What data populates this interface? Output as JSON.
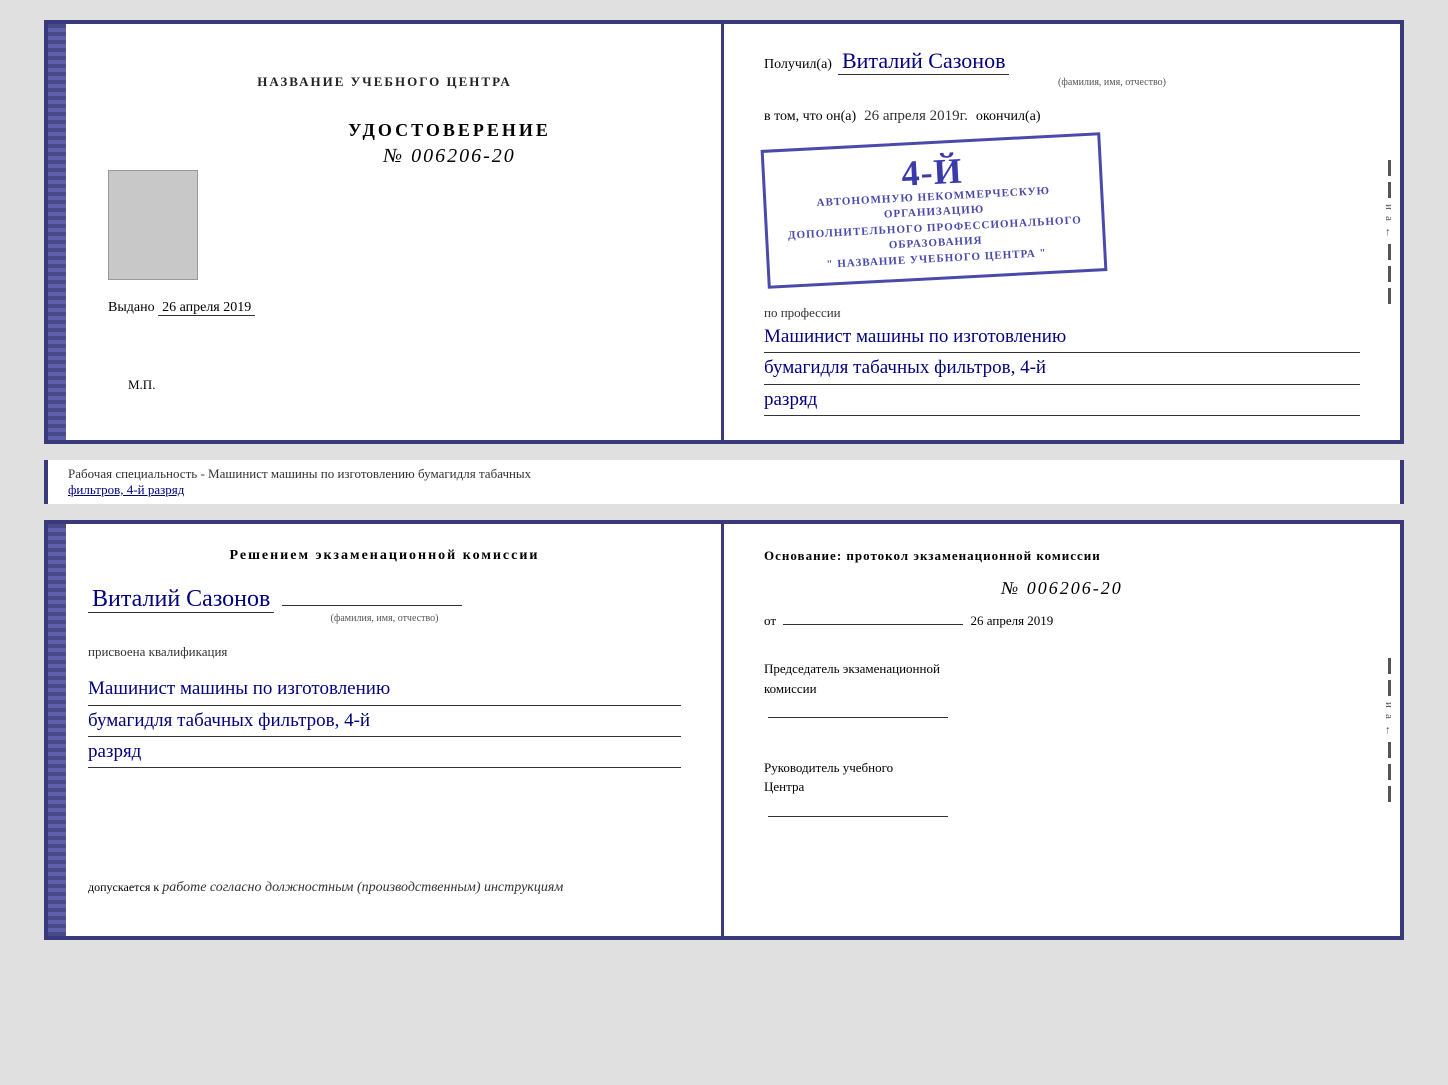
{
  "topCert": {
    "left": {
      "header": "НАЗВАНИЕ УЧЕБНОГО ЦЕНТРА",
      "title": "УДОСТОВЕРЕНИЕ",
      "number": "№ 006206-20",
      "issuedLabel": "Выдано",
      "issuedDate": "26 апреля 2019",
      "mp": "М.П."
    },
    "right": {
      "receivedLabel": "Получил(а)",
      "recipientName": "Виталий Сазонов",
      "recipientSubLabel": "(фамилия, имя, отчество)",
      "inThatLabel": "в том, что он(а)",
      "dateLabel": "26 апреля 2019г.",
      "finishedLabel": "окончил(а)",
      "stampLine1": "4-Й",
      "stampLine2": "АВТОНОМНУЮ НЕКОММЕРЧЕСКУЮ ОРГАНИЗАЦИЮ",
      "stampLine3": "ДОПОЛНИТЕЛЬНОГО ПРОФЕССИОНАЛЬНОГО ОБРАЗОВАНИЯ",
      "stampLine4": "\" НАЗВАНИЕ УЧЕБНОГО ЦЕНТРА \"",
      "professionLabel": "по профессии",
      "professionValue1": "Машинист машины по изготовлению",
      "professionValue2": "бумагидля табачных фильтров, 4-й",
      "professionValue3": "разряд"
    }
  },
  "labelStrip": {
    "text": "Рабочая специальность - Машинист машины по изготовлению бумагидля табачных",
    "underlined": "фильтров, 4-й разряд"
  },
  "bottomCert": {
    "left": {
      "decisionTitle": "Решением  экзаменационной  комиссии",
      "personName": "Виталий Сазонов",
      "personSubLabel": "(фамилия, имя, отчество)",
      "assignedLabel": "присвоена квалификация",
      "qualification1": "Машинист машины по изготовлению",
      "qualification2": "бумагидля табачных фильтров, 4-й",
      "qualification3": "разряд",
      "allowedLabel": "допускается к",
      "allowedValue": "работе согласно должностным (производственным) инструкциям"
    },
    "right": {
      "basisLabel": "Основание:  протокол  экзаменационной  комиссии",
      "protocolNumber": "№  006206-20",
      "protocolDatePrefix": "от",
      "protocolDate": "26 апреля 2019",
      "chairmanLabel": "Председатель экзаменационной\nкомиссии",
      "directorLabel": "Руководитель учебного\nЦентра"
    }
  },
  "sideMarks": {
    "letters": [
      "и",
      "а",
      "←"
    ]
  }
}
